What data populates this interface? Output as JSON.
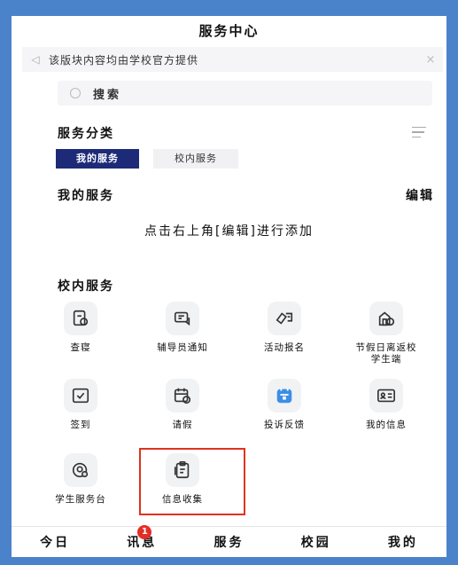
{
  "header": {
    "title": "服务中心"
  },
  "notice": {
    "text": "该版块内容均由学校官方提供",
    "close": "×"
  },
  "search": {
    "placeholder": "搜索"
  },
  "categories": {
    "title": "服务分类",
    "tabs": [
      {
        "label": "我的服务"
      },
      {
        "label": "校内服务"
      }
    ]
  },
  "my_services": {
    "title": "我的服务",
    "edit_label": "编辑",
    "empty_hint": "点击右上角[编辑]进行添加"
  },
  "campus_services": {
    "title": "校内服务",
    "items": [
      {
        "label": "查寝",
        "icon": "dorm-check-icon"
      },
      {
        "label": "辅导员通知",
        "icon": "notice-icon"
      },
      {
        "label": "活动报名",
        "icon": "activity-icon"
      },
      {
        "label": "节假日离返校学生端",
        "icon": "holiday-icon"
      },
      {
        "label": "签到",
        "icon": "checkin-icon"
      },
      {
        "label": "请假",
        "icon": "leave-icon"
      },
      {
        "label": "投诉反馈",
        "icon": "feedback-icon"
      },
      {
        "label": "我的信息",
        "icon": "profile-icon"
      },
      {
        "label": "学生服务台",
        "icon": "service-desk-icon"
      },
      {
        "label": "信息收集",
        "icon": "info-collect-icon"
      }
    ]
  },
  "bottom_nav": {
    "items": [
      {
        "label": "今日"
      },
      {
        "label": "讯息",
        "badge": "1"
      },
      {
        "label": "服务"
      },
      {
        "label": "校园"
      },
      {
        "label": "我的"
      }
    ]
  },
  "colors": {
    "accent": "#1d2a78",
    "badge": "#e52d27",
    "highlight": "#e0321f",
    "frame": "#4a83c9"
  }
}
